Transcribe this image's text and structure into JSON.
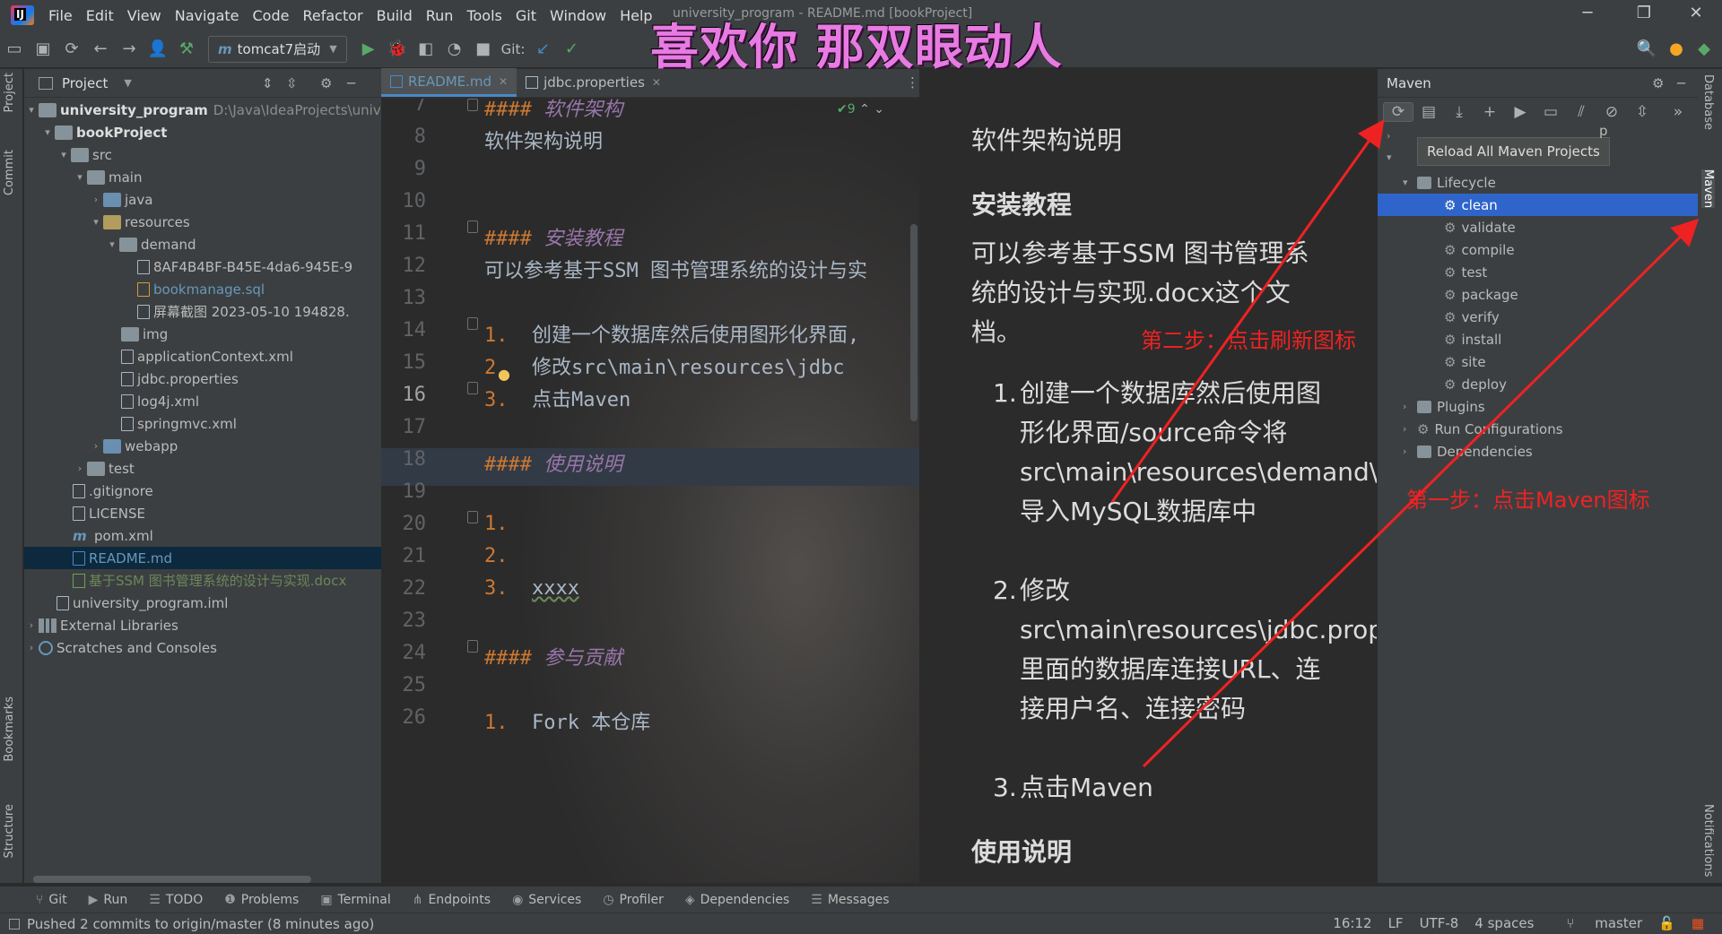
{
  "menubar": {
    "items": [
      "File",
      "Edit",
      "View",
      "Navigate",
      "Code",
      "Refactor",
      "Build",
      "Run",
      "Tools",
      "Git",
      "Window",
      "Help"
    ],
    "window_title": "university_program - README.md [bookProject]"
  },
  "overlay_title": "喜欢你 那双眼动人",
  "toolbar": {
    "run_config": "tomcat7启动",
    "git_label": "Git:"
  },
  "left_stripe": {
    "tabs": [
      "Project",
      "Commit",
      "Bookmarks",
      "Structure"
    ]
  },
  "project_panel": {
    "title": "Project",
    "root": "university_program",
    "root_path": "D:\\Java\\IdeaProjects\\unive",
    "items": [
      "bookProject",
      "src",
      "main",
      "java",
      "resources",
      "demand",
      "8AF4B4BF-B45E-4da6-945E-9",
      "bookmanage.sql",
      "屏幕截图 2023-05-10 194828.",
      "img",
      "applicationContext.xml",
      "jdbc.properties",
      "log4j.xml",
      "springmvc.xml",
      "webapp",
      "test",
      ".gitignore",
      "LICENSE",
      "pom.xml",
      "README.md",
      "基于SSM 图书管理系统的设计与实现.docx",
      "university_program.iml",
      "External Libraries",
      "Scratches and Consoles"
    ]
  },
  "editor": {
    "tabs": [
      "README.md",
      "jdbc.properties"
    ],
    "inspection_count": "9",
    "line_numbers": [
      "7",
      "8",
      "9",
      "10",
      "11",
      "12",
      "13",
      "14",
      "15",
      "16",
      "17",
      "18",
      "19",
      "20",
      "21",
      "22",
      "23",
      "24",
      "25",
      "26"
    ],
    "lines": {
      "l7_mark": "####",
      "l7_text": "软件架构",
      "l8": "软件架构说明",
      "l11_mark": "####",
      "l11_text": "安装教程",
      "l12": "可以参考基于SSM 图书管理系统的设计与实",
      "l14_num": "1.",
      "l14": "创建一个数据库然后使用图形化界面,",
      "l15_num": "2.",
      "l15": "修改src\\main\\resources\\jdbc",
      "l16_num": "3.",
      "l16": "点击Maven",
      "l18_mark": "####",
      "l18_text": "使用说明",
      "l20_num": "1.",
      "l21_num": "2.",
      "l22_num": "3.",
      "l22": "xxxx",
      "l24_mark": "####",
      "l24_text": "参与贡献",
      "l26_num": "1.",
      "l26": "Fork 本仓库"
    }
  },
  "preview": {
    "arch_desc": "软件架构说明",
    "install_heading": "安装教程",
    "install_desc": "可以参考基于SSM 图书管理系统的设计与实现.docx这个文档。",
    "step1": "创建一个数据库然后使用图形化界面/source命令将src\\main\\resources\\demand\\bookmanage.sql导入MySQL数据库中",
    "step2": "修改src\\main\\resources\\jdbc.properties里面的数据库连接URL、连接用户名、连接密码",
    "step3": "点击Maven",
    "n1": "1.",
    "n2": "2.",
    "n3": "3.",
    "usage_heading": "使用说明"
  },
  "maven": {
    "title": "Maven",
    "tooltip": "Reload All Maven Projects",
    "lifecycle": "Lifecycle",
    "goals": [
      "clean",
      "validate",
      "compile",
      "test",
      "package",
      "verify",
      "install",
      "site",
      "deploy"
    ],
    "plugins": "Plugins",
    "run_configs": "Run Configurations",
    "dependencies": "Dependencies",
    "partial_p": "p"
  },
  "right_stripe": {
    "tabs": [
      "Database",
      "Maven",
      "Notifications"
    ]
  },
  "annotations": {
    "step2": "第二步：点击刷新图标",
    "step1": "第一步：点击Maven图标",
    "color": "#ee2222"
  },
  "bottom_tabs": [
    "Git",
    "Run",
    "TODO",
    "Problems",
    "Terminal",
    "Endpoints",
    "Services",
    "Profiler",
    "Dependencies",
    "Messages"
  ],
  "status": {
    "message": "Pushed 2 commits to origin/master (8 minutes ago)",
    "position": "16:12",
    "line_sep": "LF",
    "encoding": "UTF-8",
    "indent": "4 spaces",
    "branch": "master"
  }
}
